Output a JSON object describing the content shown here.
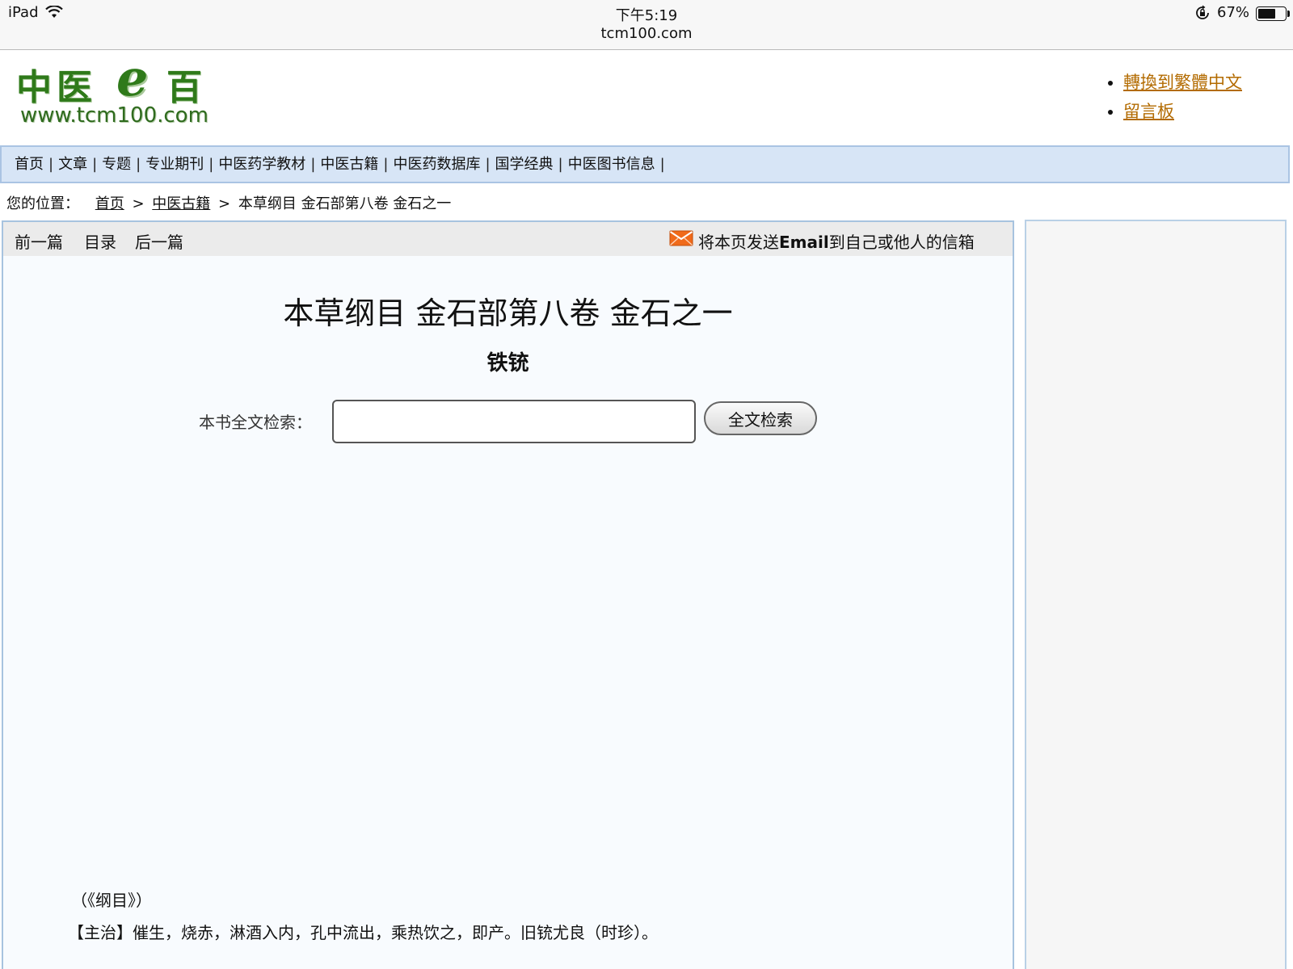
{
  "status_bar": {
    "device": "iPad",
    "time": "下午5:19",
    "url": "tcm100.com",
    "battery_text": "67%",
    "battery_level": 0.67
  },
  "logo": {
    "cn_left": "中医",
    "cn_e": "e",
    "cn_right": "百",
    "url": "www.tcm100.com"
  },
  "top_links": [
    "轉換到繁體中文",
    "留言板"
  ],
  "nav": {
    "items": [
      "首页",
      "文章",
      "专题",
      "专业期刊",
      "中医药学教材",
      "中医古籍",
      "中医药数据库",
      "国学经典",
      "中医图书信息"
    ],
    "separator": "|"
  },
  "breadcrumb": {
    "prefix": "您的位置：",
    "links": [
      "首页",
      "中医古籍"
    ],
    "current": "本草纲目 金石部第八卷 金石之一",
    "separator": ">"
  },
  "toolbar": {
    "prev": "前一篇",
    "toc": "目录",
    "next": "后一篇",
    "email_before": "将本页发送",
    "email_bold": "Email",
    "email_after": "到自己或他人的信箱"
  },
  "article": {
    "title": "本草纲目 金石部第八卷 金石之一",
    "subtitle": "铁铳",
    "search_label": "本书全文检索：",
    "search_value": "",
    "search_button": "全文检索",
    "lines": [
      "（《纲目》）",
      "【主治】催生，烧赤，淋酒入内，孔中流出，乘热饮之，即产。旧铳尤良（时珍）。"
    ]
  },
  "colors": {
    "nav_bg": "#d7e5f6",
    "link_orange": "#b36b00",
    "logo_green": "#2f7a1a",
    "mail_orange": "#f06a1a"
  }
}
